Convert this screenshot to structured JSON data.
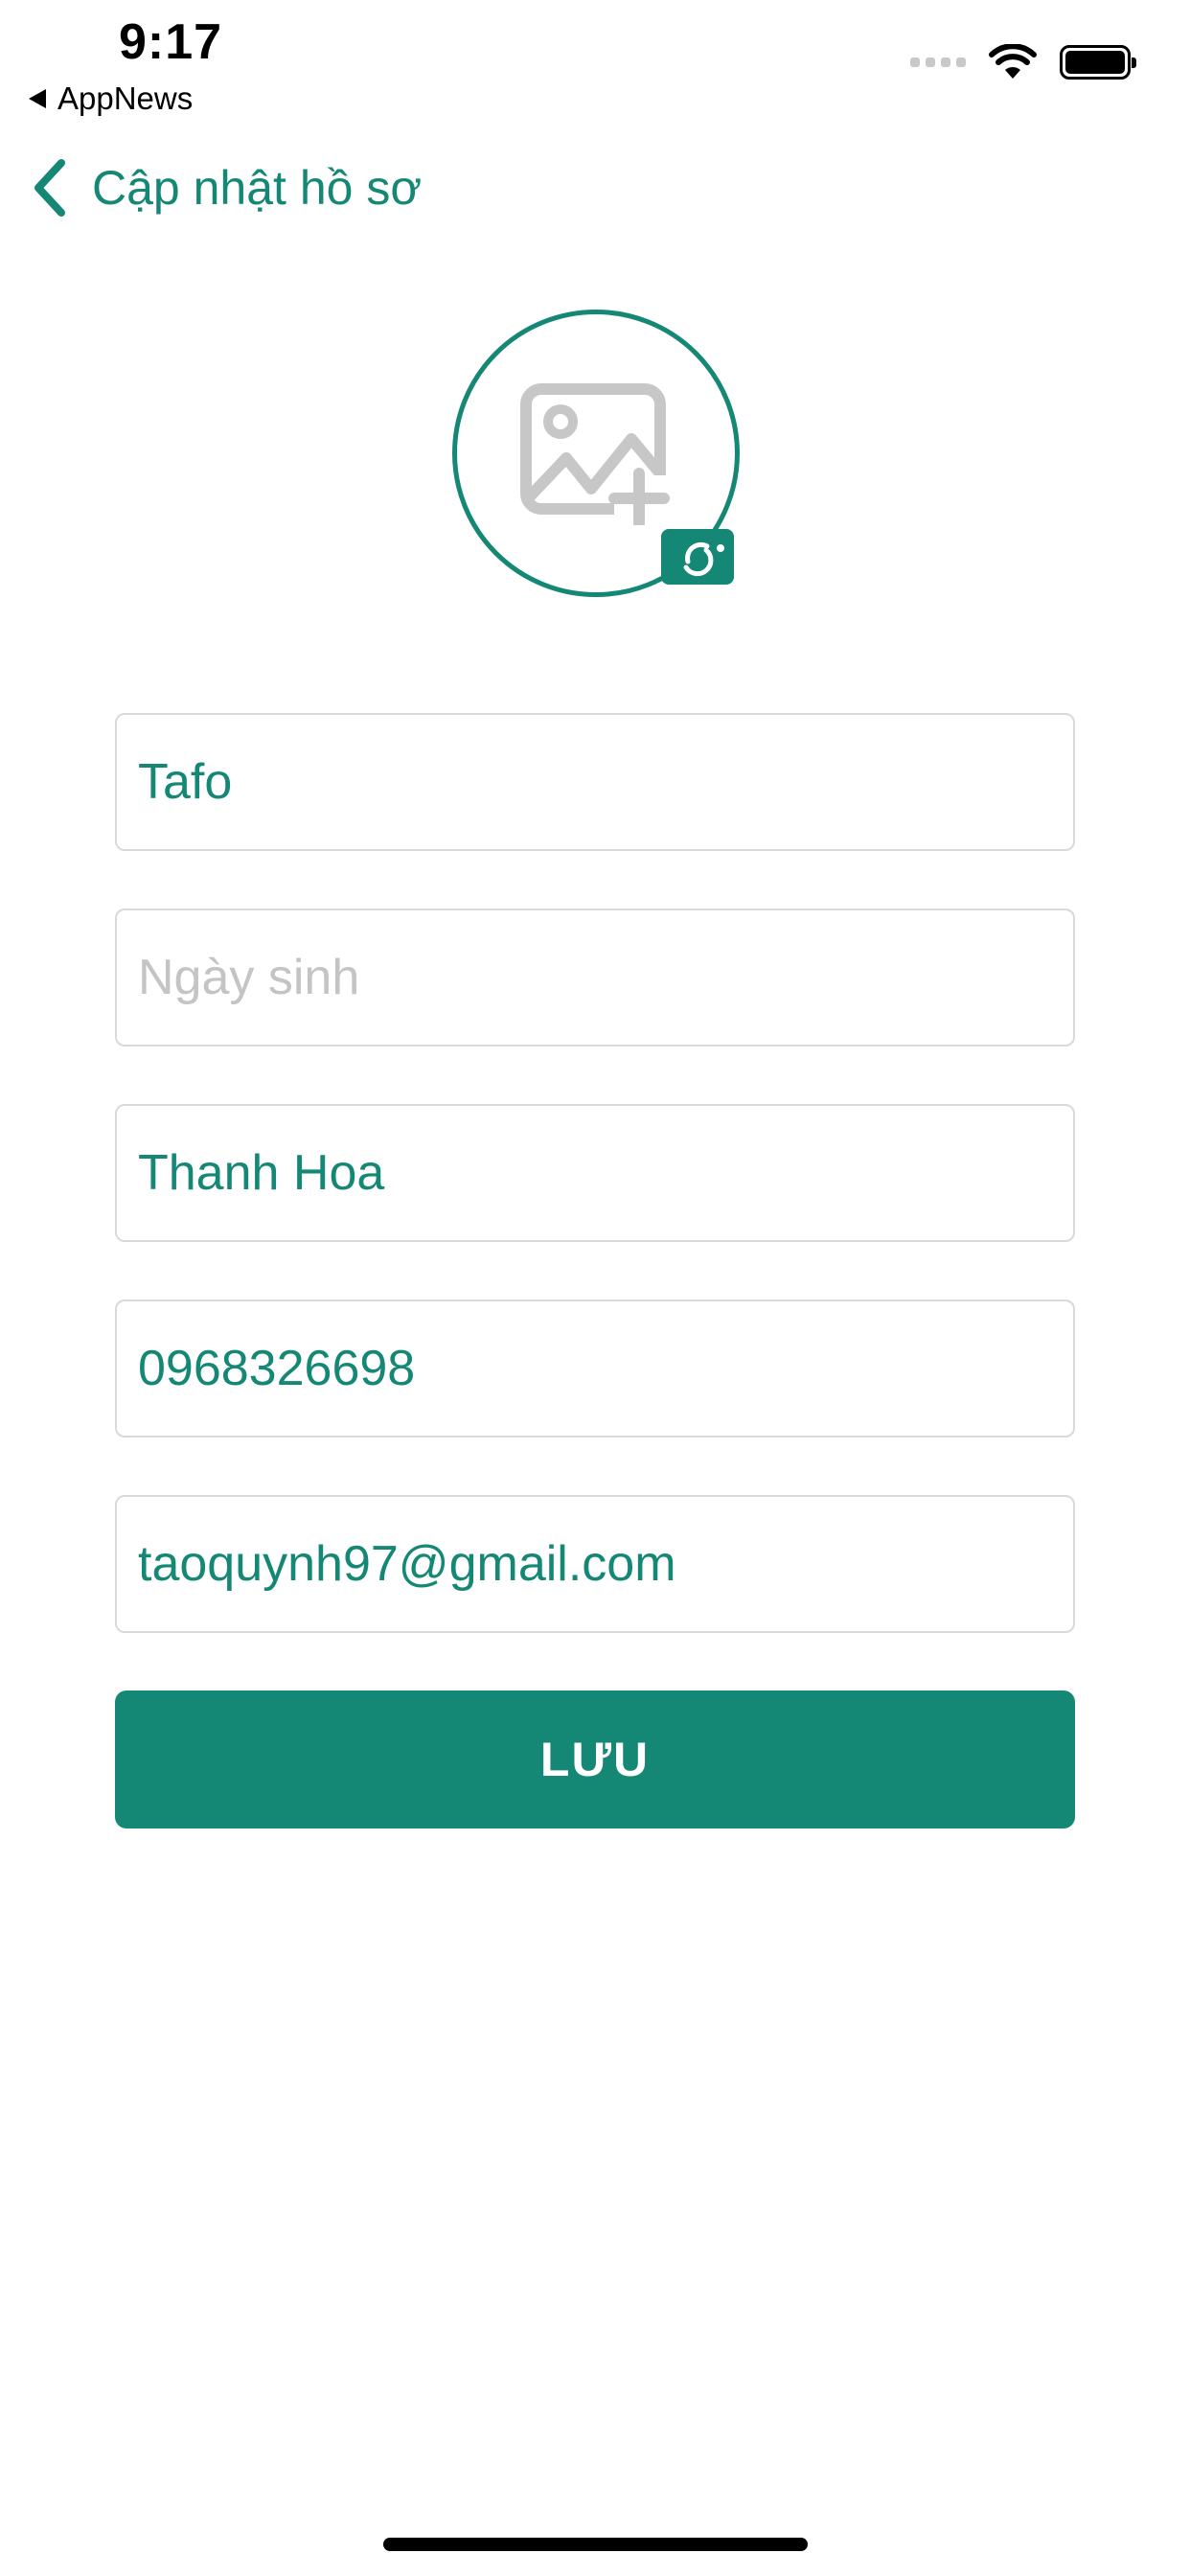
{
  "status_bar": {
    "time": "9:17",
    "back_app": "AppNews",
    "signal_icon": "signal-bars-icon",
    "wifi_icon": "wifi-icon",
    "battery_icon": "battery-icon"
  },
  "header": {
    "back_icon": "chevron-left-icon",
    "title": "Cập nhật hồ sơ"
  },
  "avatar": {
    "placeholder_icon": "image-add-icon",
    "camera_icon": "camera-rotate-icon"
  },
  "form": {
    "name": {
      "value": "Tafo",
      "placeholder": ""
    },
    "birthday": {
      "value": "",
      "placeholder": "Ngày sinh"
    },
    "address": {
      "value": "Thanh Hoa",
      "placeholder": ""
    },
    "phone": {
      "value": "0968326698",
      "placeholder": ""
    },
    "email": {
      "value": "taoquynh97@gmail.com",
      "placeholder": ""
    },
    "save_label": "LƯU"
  },
  "colors": {
    "accent": "#158775",
    "border": "#d9d9d9",
    "placeholder": "#c4c4c6"
  }
}
